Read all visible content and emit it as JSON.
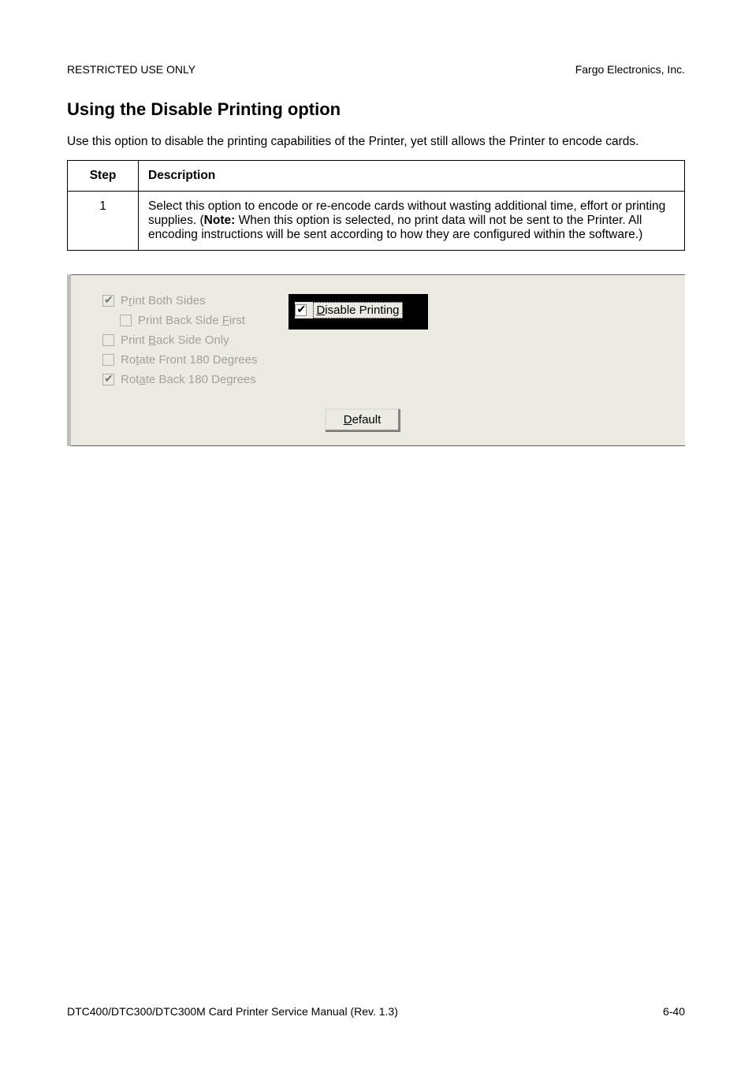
{
  "header": {
    "left": "RESTRICTED USE ONLY",
    "right": "Fargo Electronics, Inc."
  },
  "title": "Using the Disable Printing option",
  "intro": "Use this option to disable the printing capabilities of the Printer, yet still allows the Printer to encode cards.",
  "table": {
    "head_step": "Step",
    "head_desc": "Description",
    "row1_num": "1",
    "row1_a": "Select this option to encode or re-encode cards without wasting additional time, effort or printing supplies. (",
    "row1_note": "Note:",
    "row1_b": "  When this option is selected, no print data will not be sent to the Printer. All encoding instructions will be sent according to how they are configured within the software.)"
  },
  "shot": {
    "c1_pre": "P",
    "c1_mid": "r",
    "c1_post": "int Both Sides",
    "c2_pre": "Print Back Side ",
    "c2_mid": "F",
    "c2_post": "irst",
    "c3_pre": "Print ",
    "c3_mid": "B",
    "c3_post": "ack Side Only",
    "c4_pre": "Ro",
    "c4_mid": "t",
    "c4_post": "ate Front 180 Degrees",
    "c5_pre": "Rot",
    "c5_mid": "a",
    "c5_post": "te Back 180 Degrees",
    "dis_pre": "D",
    "dis_post": "isable Printing",
    "btn_pre": "D",
    "btn_post": "efault"
  },
  "footer": {
    "left": "DTC400/DTC300/DTC300M Card Printer Service Manual (Rev. 1.3)",
    "right": "6-40"
  }
}
